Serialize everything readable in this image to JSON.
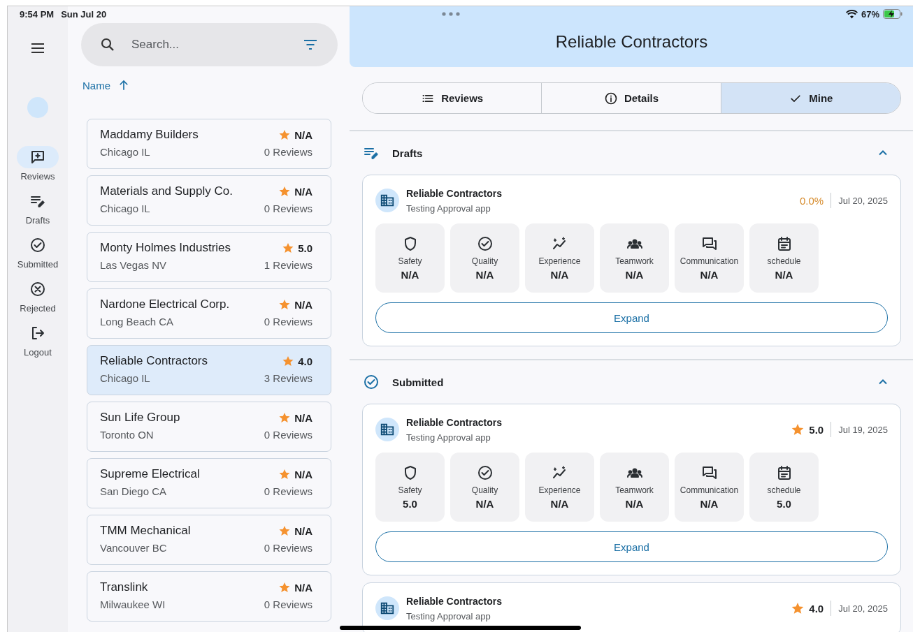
{
  "status_bar": {
    "time": "9:54 PM",
    "date": "Sun Jul 20",
    "battery": "67%"
  },
  "nav": {
    "items": [
      {
        "label": "Reviews",
        "kind": "reviews",
        "selected": true
      },
      {
        "label": "Drafts",
        "kind": "drafts",
        "selected": false
      },
      {
        "label": "Submitted",
        "kind": "submitted",
        "selected": false
      },
      {
        "label": "Rejected",
        "kind": "rejected",
        "selected": false
      },
      {
        "label": "Logout",
        "kind": "logout",
        "selected": false
      }
    ]
  },
  "search": {
    "placeholder": "Search..."
  },
  "sort": {
    "label": "Name",
    "ascending": true
  },
  "contractors": [
    {
      "name": "Maddamy Builders",
      "location": "Chicago IL",
      "rating": "N/A",
      "reviews": "0 Reviews",
      "selected": false
    },
    {
      "name": "Materials and Supply Co.",
      "location": "Chicago IL",
      "rating": "N/A",
      "reviews": "0 Reviews",
      "selected": false
    },
    {
      "name": "Monty Holmes Industries",
      "location": "Las Vegas NV",
      "rating": "5.0",
      "reviews": "1 Reviews",
      "selected": false
    },
    {
      "name": "Nardone Electrical Corp.",
      "location": "Long Beach CA",
      "rating": "N/A",
      "reviews": "0 Reviews",
      "selected": false
    },
    {
      "name": "Reliable Contractors",
      "location": "Chicago IL",
      "rating": "4.0",
      "reviews": "3 Reviews",
      "selected": true
    },
    {
      "name": "Sun Life Group",
      "location": "Toronto ON",
      "rating": "N/A",
      "reviews": "0 Reviews",
      "selected": false
    },
    {
      "name": "Supreme Electrical",
      "location": "San Diego CA",
      "rating": "N/A",
      "reviews": "0 Reviews",
      "selected": false
    },
    {
      "name": "TMM Mechanical",
      "location": "Vancouver BC",
      "rating": "N/A",
      "reviews": "0 Reviews",
      "selected": false
    },
    {
      "name": "Translink",
      "location": "Milwaukee WI",
      "rating": "N/A",
      "reviews": "0 Reviews",
      "selected": false
    }
  ],
  "header": {
    "title": "Reliable Contractors"
  },
  "tabs": [
    {
      "label": "Reviews",
      "kind": "list",
      "selected": false
    },
    {
      "label": "Details",
      "kind": "info",
      "selected": false
    },
    {
      "label": "Mine",
      "kind": "check",
      "selected": true
    }
  ],
  "sections": [
    {
      "title": "Drafts",
      "kind": "drafts",
      "expanded": true,
      "reviews": [
        {
          "name": "Reliable Contractors",
          "subtitle": "Testing Approval app",
          "kind": "percent",
          "score": "0.0%",
          "date": "Jul 20, 2025",
          "button": "Expand",
          "metrics": [
            {
              "kind": "safety",
              "label": "Safety",
              "value": "N/A"
            },
            {
              "kind": "quality",
              "label": "Quality",
              "value": "N/A"
            },
            {
              "kind": "experience",
              "label": "Experience",
              "value": "N/A"
            },
            {
              "kind": "teamwork",
              "label": "Teamwork",
              "value": "N/A"
            },
            {
              "kind": "communication",
              "label": "Communication",
              "value": "N/A"
            },
            {
              "kind": "schedule",
              "label": "schedule",
              "value": "N/A"
            }
          ]
        }
      ]
    },
    {
      "title": "Submitted",
      "kind": "submitted",
      "expanded": true,
      "reviews": [
        {
          "name": "Reliable Contractors",
          "subtitle": "Testing Approval app",
          "kind": "rating",
          "score": "5.0",
          "date": "Jul 19, 2025",
          "button": "Expand",
          "metrics": [
            {
              "kind": "safety",
              "label": "Safety",
              "value": "5.0"
            },
            {
              "kind": "quality",
              "label": "Quality",
              "value": "N/A"
            },
            {
              "kind": "experience",
              "label": "Experience",
              "value": "N/A"
            },
            {
              "kind": "teamwork",
              "label": "Teamwork",
              "value": "N/A"
            },
            {
              "kind": "communication",
              "label": "Communication",
              "value": "N/A"
            },
            {
              "kind": "schedule",
              "label": "schedule",
              "value": "5.0"
            }
          ]
        },
        {
          "name": "Reliable Contractors",
          "subtitle": "Testing Approval app",
          "kind": "rating",
          "score": "4.0",
          "date": "Jul 20, 2025"
        }
      ]
    }
  ]
}
